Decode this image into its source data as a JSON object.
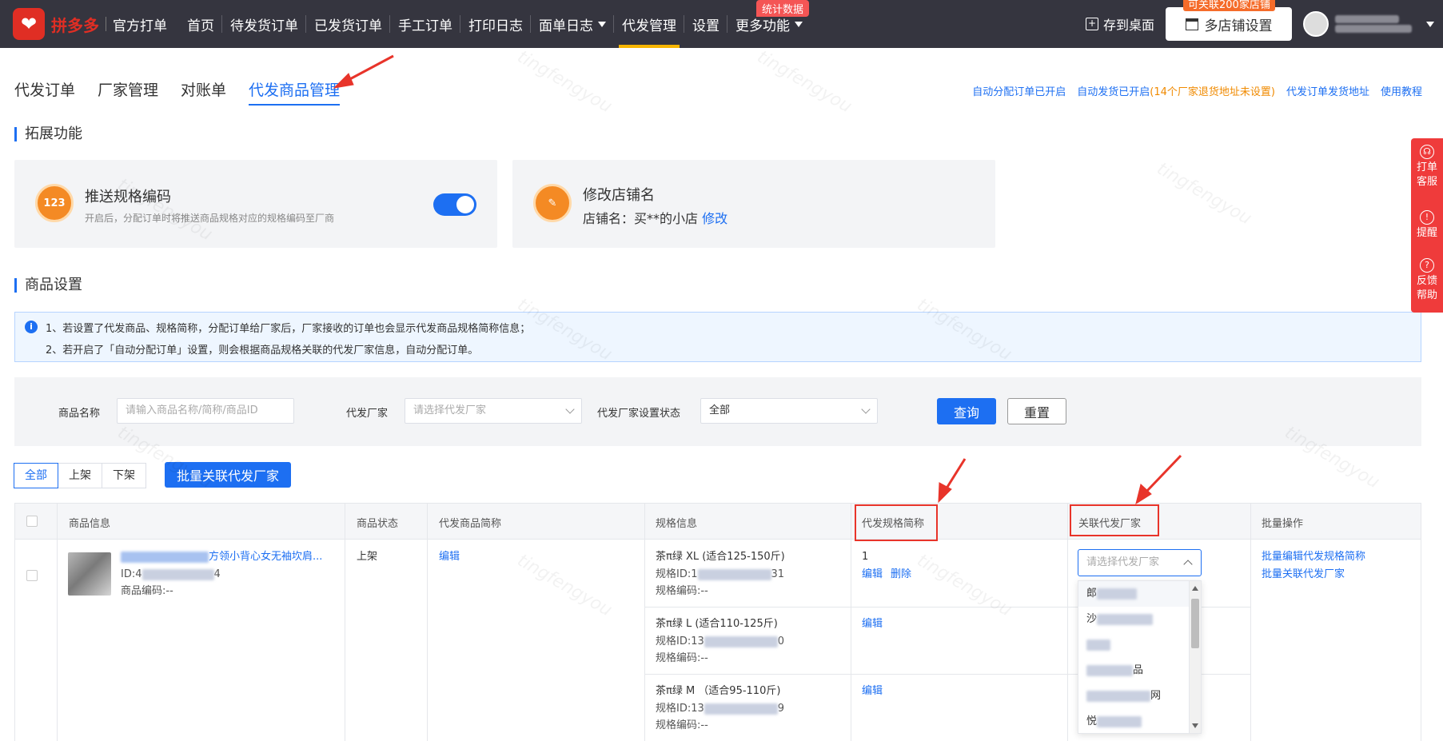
{
  "header": {
    "logo_text": "拼多多",
    "logo_sub": "官方打单",
    "nav": [
      {
        "label": "首页"
      },
      {
        "label": "待发货订单"
      },
      {
        "label": "已发货订单"
      },
      {
        "label": "手工订单"
      },
      {
        "label": "打印日志"
      },
      {
        "label": "面单日志"
      },
      {
        "label": "代发管理"
      },
      {
        "label": "设置"
      },
      {
        "label": "更多功能"
      }
    ],
    "more_badge": "统计数据",
    "save_desktop": "存到桌面",
    "multi_shop": "多店铺设置",
    "multi_shop_badge": "可关联200家店铺"
  },
  "tabs": [
    {
      "label": "代发订单"
    },
    {
      "label": "厂家管理"
    },
    {
      "label": "对账单"
    },
    {
      "label": "代发商品管理"
    }
  ],
  "top_links": {
    "auto_assign": "自动分配订单已开启",
    "auto_ship": "自动发货已开启",
    "auto_ship_warn": "(14个厂家退货地址未设置)",
    "ship_address": "代发订单发货地址",
    "tutorial": "使用教程"
  },
  "extension": {
    "section_title": "拓展功能",
    "push_spec": {
      "icon_text": "123",
      "title": "推送规格编码",
      "desc": "开启后，分配订单时将推送商品规格对应的规格编码至厂商",
      "enabled": true
    },
    "rename_shop": {
      "title": "修改店铺名",
      "shop_label": "店铺名：买**的小店",
      "edit_link": "修改"
    }
  },
  "product_settings": {
    "section_title": "商品设置",
    "notice_1": "1、若设置了代发商品、规格简称，分配订单给厂家后，厂家接收的订单也会显示代发商品规格简称信息；",
    "notice_2": "2、若开启了「自动分配订单」设置，则会根据商品规格关联的代发厂家信息，自动分配订单。"
  },
  "filter": {
    "name_label": "商品名称",
    "name_placeholder": "请输入商品名称/简称/商品ID",
    "vendor_label": "代发厂家",
    "vendor_placeholder": "请选择代发厂家",
    "status_label": "代发厂家设置状态",
    "status_value": "全部",
    "search_btn": "查询",
    "reset_btn": "重置"
  },
  "segment": [
    "全部",
    "上架",
    "下架"
  ],
  "batch_btn": "批量关联代发厂家",
  "table": {
    "headers": {
      "info": "商品信息",
      "status": "商品状态",
      "short_name": "代发商品简称",
      "spec": "规格信息",
      "spec_short": "代发规格简称",
      "vendor": "关联代发厂家",
      "batch": "批量操作"
    },
    "product": {
      "title_tail": "方领小背心女无袖坎肩...",
      "id_label": "ID:4",
      "id_tail": "4",
      "code": "商品编码:--",
      "status": "上架",
      "short_edit": "编辑"
    },
    "specs": [
      {
        "name": "茶π绿 XL (适合125-150斤)",
        "id_prefix": "规格ID:1",
        "id_tail": "31",
        "code": "规格编码:--",
        "short": "1",
        "edit": "编辑",
        "delete": "删除"
      },
      {
        "name": "茶π绿 L (适合110-125斤)",
        "id_prefix": "规格ID:13",
        "id_tail": "0",
        "code": "规格编码:--",
        "edit": "编辑"
      },
      {
        "name": "茶π绿 M （适合95-110斤)",
        "id_prefix": "规格ID:13",
        "id_tail": "9",
        "code": "规格编码:--",
        "edit": "编辑"
      }
    ],
    "vendor_placeholder": "请选择代发厂家",
    "vendor_options": [
      {
        "prefix": "郎"
      },
      {
        "prefix": "沙"
      },
      {
        "prefix": ""
      },
      {
        "prefix": "",
        "suffix": "品"
      },
      {
        "prefix": "",
        "suffix": "网"
      },
      {
        "prefix": "悦"
      }
    ],
    "batch_ops": {
      "edit_short": "批量编辑代发规格简称",
      "link_vendor": "批量关联代发厂家"
    }
  },
  "side_float": {
    "service_1": "打单",
    "service_2": "客服",
    "remind": "提醒",
    "feedback_1": "反馈",
    "feedback_2": "帮助"
  },
  "watermark": "tingfengyou"
}
